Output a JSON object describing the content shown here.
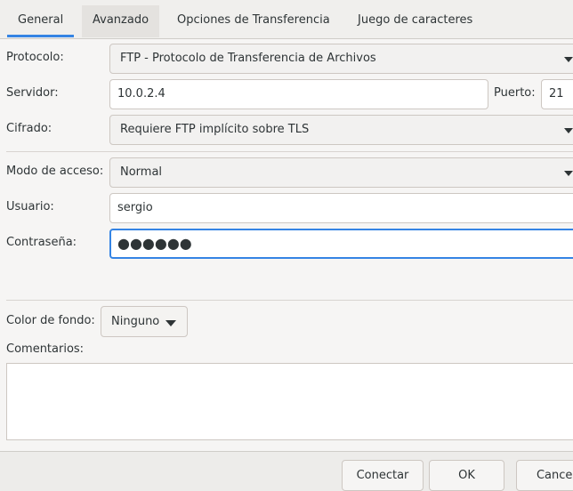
{
  "tabs": {
    "general": "General",
    "avanzado": "Avanzado",
    "transfer": "Opciones de Transferencia",
    "charset": "Juego de caracteres"
  },
  "form": {
    "protocol_label": "Protocolo:",
    "protocol_value": "FTP - Protocolo de Transferencia de Archivos",
    "server_label": "Servidor:",
    "server_value": "10.0.2.4",
    "port_label": "Puerto:",
    "port_value": "21",
    "encryption_label": "Cifrado:",
    "encryption_value": "Requiere FTP implícito sobre TLS",
    "access_label": "Modo de acceso:",
    "access_value": "Normal",
    "user_label": "Usuario:",
    "user_value": "sergio",
    "password_label": "Contraseña:",
    "password_mask": "●●●●●●",
    "bgcolor_label": "Color de fondo:",
    "bgcolor_value": "Ninguno",
    "comments_label": "Comentarios:"
  },
  "footer": {
    "connect": "Conectar",
    "ok": "OK",
    "cancel": "Cancel"
  },
  "colors": {
    "accent": "#3584e4",
    "window_bg": "#f6f5f4"
  }
}
